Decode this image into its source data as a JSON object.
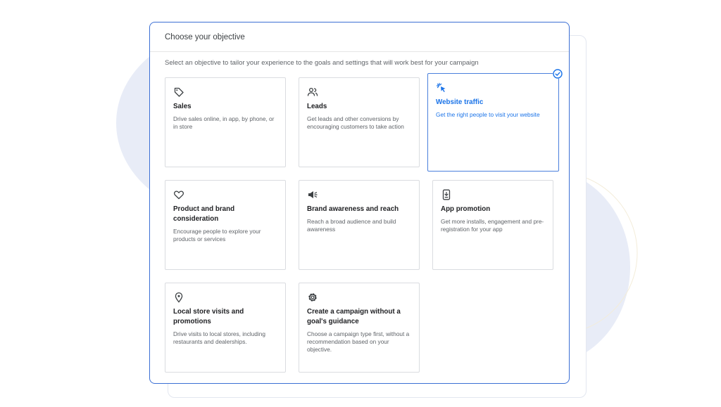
{
  "panel": {
    "title": "Choose your objective",
    "subtitle": "Select an objective to tailor your experience to the goals and settings that will work best for your campaign"
  },
  "objectives": [
    {
      "title": "Sales",
      "description": "Drive sales online, in app, by phone, or in store",
      "icon": "tag-icon",
      "selected": false
    },
    {
      "title": "Leads",
      "description": "Get leads and other conversions by encouraging customers to take action",
      "icon": "people-icon",
      "selected": false
    },
    {
      "title": "Website traffic",
      "description": "Get the right people to visit your website",
      "icon": "cursor-click-icon",
      "selected": true
    },
    {
      "title": "Product and brand consideration",
      "description": "Encourage people to explore your products or services",
      "icon": "heart-icon",
      "selected": false
    },
    {
      "title": "Brand awareness and reach",
      "description": "Reach a broad audience and build awareness",
      "icon": "megaphone-icon",
      "selected": false
    },
    {
      "title": "App promotion",
      "description": "Get more installs, engagement and pre-registration for your app",
      "icon": "phone-download-icon",
      "selected": false
    },
    {
      "title": "Local store visits and promotions",
      "description": "Drive visits to local stores, including restaurants and dealerships.",
      "icon": "location-pin-icon",
      "selected": false
    },
    {
      "title": "Create a campaign without a goal's guidance",
      "description": "Choose a campaign type first, without a recommendation based on your objective.",
      "icon": "gear-icon",
      "selected": false
    }
  ],
  "colors": {
    "accent": "#1a73e8",
    "panel_border": "#3b6fd4",
    "background_blob": "#e8ecf7"
  }
}
